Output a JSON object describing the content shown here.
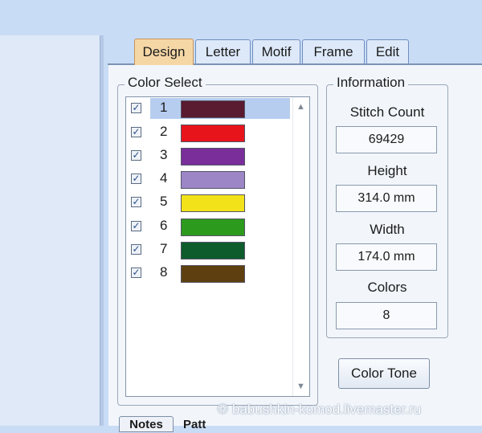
{
  "tabs": [
    {
      "label": "Design",
      "active": true
    },
    {
      "label": "Letter",
      "active": false
    },
    {
      "label": "Motif",
      "active": false
    },
    {
      "label": "Frame",
      "active": false
    },
    {
      "label": "Edit",
      "active": false
    }
  ],
  "color_select": {
    "legend": "Color Select",
    "items": [
      {
        "number": "1",
        "checked": true,
        "color": "#5a1a30",
        "selected": true
      },
      {
        "number": "2",
        "checked": true,
        "color": "#e8141c",
        "selected": false
      },
      {
        "number": "3",
        "checked": true,
        "color": "#7a2e9a",
        "selected": false
      },
      {
        "number": "4",
        "checked": true,
        "color": "#9c86c6",
        "selected": false
      },
      {
        "number": "5",
        "checked": true,
        "color": "#f2e21a",
        "selected": false
      },
      {
        "number": "6",
        "checked": true,
        "color": "#2c9a1c",
        "selected": false
      },
      {
        "number": "7",
        "checked": true,
        "color": "#0e5c2c",
        "selected": false
      },
      {
        "number": "8",
        "checked": true,
        "color": "#5e4010",
        "selected": false
      }
    ]
  },
  "information": {
    "legend": "Information",
    "stitch_count_label": "Stitch Count",
    "stitch_count": "69429",
    "height_label": "Height",
    "height": "314.0 mm",
    "width_label": "Width",
    "width": "174.0 mm",
    "colors_label": "Colors",
    "colors": "8"
  },
  "buttons": {
    "color_tone": "Color Tone",
    "notes": "Notes",
    "partial": "Patt"
  },
  "watermark": "❁ babushkin-komod.livemaster.ru",
  "check_glyph": "✓"
}
